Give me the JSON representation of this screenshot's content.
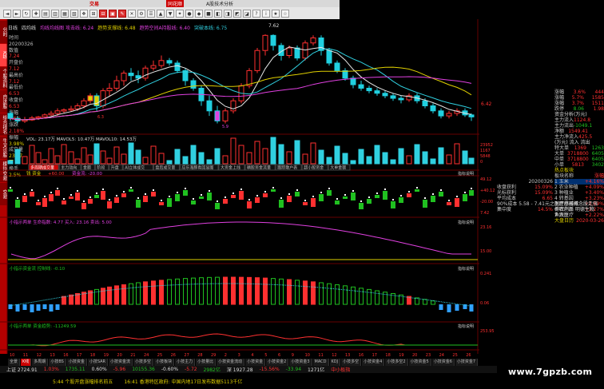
{
  "titlebar": {
    "app_brand": "同花顺",
    "menu": "交易",
    "window_title": "A股技术分析"
  },
  "toolbar": {
    "buttons": [
      "◄",
      "►",
      "↻",
      "✚",
      "▤",
      "▥",
      "▦",
      "▧",
      "❖",
      "⊞",
      "⊟",
      "▣",
      "✎",
      "✕",
      "⚙",
      "☰",
      "▲",
      "▼",
      "✦",
      "●",
      "◆",
      "■",
      "◧",
      "◨",
      "◩",
      "◪",
      "?",
      "i",
      "★",
      "☆"
    ]
  },
  "left_tabs": [
    "分时",
    "K线",
    "个股资料",
    "自选股",
    "综合排名",
    "牛叉诊股",
    "模拟交易",
    "交易"
  ],
  "info_header": {
    "period": "日线",
    "ma_label": "四均线",
    "ma5": "均线均线图 攻击线: 6.24",
    "ma10": "趋势支撑线: 6.48",
    "ma20": "趋势空间A持股线: 6.40",
    "ma60": "突破本线: 6.75"
  },
  "stock_info": [
    {
      "label": "时间",
      "value": ""
    },
    {
      "label": "20200326",
      "value": ""
    },
    {
      "label": "数值",
      "value": "7.24"
    },
    {
      "label": "开盘价",
      "value": "7.12"
    },
    {
      "label": "最高价",
      "value": "7.12"
    },
    {
      "label": "最低价",
      "value": "6.53"
    },
    {
      "label": "收盘价",
      "value": "6.53"
    },
    {
      "label": "涨幅",
      "value": "0.6%"
    },
    {
      "label": "涨跌",
      "value": "2.18%"
    },
    {
      "label": "振幅",
      "value": "3.98%"
    },
    {
      "label": "成交量",
      "value": "23.17万"
    },
    {
      "label": "换手",
      "value": "2.5%"
    }
  ],
  "price_labels": {
    "p742": "7.42",
    "p629": "6.29",
    "p5xx": "5.8",
    "p642": "6.42",
    "peak": "7.62"
  },
  "volume_panel": {
    "header": "VOL: 23.17万  MAVOL5: 10.47万  MAVOL10: 14.53万",
    "ticks": [
      "23952",
      "1167",
      "5848",
      "0"
    ],
    "h1": "万"
  },
  "indicator_tabs": [
    "多周期成交量",
    "主力动向",
    "金额",
    "阶段",
    "升盘",
    "AI立体成交",
    "盘后成交量",
    "应乐海豚看回显图",
    "大资金上线",
    "精股资金流量",
    "跟踪散户表",
    "超小股资金",
    "大单金额"
  ],
  "money_panel": {
    "title": "钱 资金",
    "v1": "+60.00",
    "v2": "资金流: -20.00",
    "v3": "6.00",
    "label_right": "指标说明",
    "ticks": [
      "49.12",
      "+40.12",
      "-20.00",
      "7.42"
    ]
  },
  "macd_panel": {
    "header": "小指示两单 生命指数: 4.77  买入: 23.16  卖出: 5.00",
    "label_right": "指标说明",
    "ticks": [
      "23.16",
      "15.00"
    ]
  },
  "hist_panel": {
    "header": "小指示资金流 控制线: -0.10",
    "label_right": "指标说明",
    "ticks": [
      "0.241",
      "0.06"
    ]
  },
  "line_panel": {
    "header": "小指示两单 资金趋势: -11249.59",
    "label_right": "指标说明",
    "ticks": [
      "253.95"
    ]
  },
  "x_axis_dates": [
    "10",
    "11",
    "12",
    "13",
    "16",
    "17",
    "18",
    "19",
    "20",
    "21",
    "24",
    "25",
    "26",
    "27",
    "28",
    "29",
    "2",
    "3",
    "4",
    "5",
    "6",
    "9",
    "10",
    "11",
    "12",
    "13",
    "16",
    "17",
    "18",
    "19",
    "20",
    "23",
    "24",
    "25",
    "26"
  ],
  "bottom_tabs": [
    "全景",
    "K线",
    "多周期",
    "小技BS",
    "小技资金",
    "小技SAR",
    "小技资金流",
    "小技多空",
    "小技板块",
    "小技主力",
    "小技量比",
    "小技资金流动",
    "小技资金",
    "小技资金2",
    "小技资金3",
    "MACD",
    "KDJ",
    "小技多空",
    "小技资金4",
    "小技多空2",
    "小技资金5",
    "小技资金6",
    "小技资金7"
  ],
  "status_bar": [
    "上证 2724.91",
    "1.03%",
    "1735.11",
    "0.60%",
    "-5.96",
    "10155.36",
    "-0.60%",
    "-5.72",
    "2982亿",
    "深 1927.28",
    "-15.56%",
    "-33.94",
    "1271亿",
    "中小板指"
  ],
  "ticker": {
    "item1": "5:44 个股开盘涨幅排名前五",
    "item2": "16:41 香港特区政府: 中国内地17日发布数据5113千亿"
  },
  "right_panel": {
    "rows": [
      {
        "l": "涨幅",
        "v1": "3.6%",
        "v2": "444"
      },
      {
        "l": "涨幅",
        "v1": "5.7%",
        "v2": "1585"
      },
      {
        "l": "涨幅",
        "v1": "3.7%",
        "v2": "1511"
      },
      {
        "l": "跌停",
        "v1": "8.06",
        "v2": "1.98"
      }
    ],
    "cash_title": "资金分析(万元)",
    "cash": [
      {
        "l": "主力流入",
        "v": "1124.8"
      },
      {
        "l": "主力流出",
        "v": "-1049.1"
      },
      {
        "l": "净额",
        "v": "1549.41"
      },
      {
        "l": "主力净流入",
        "v": "425.5"
      }
    ],
    "order_title": "(万元)  流入  流出",
    "orders": [
      {
        "l": "特大单",
        "v1": "1369",
        "v2": "1263"
      },
      {
        "l": "大单",
        "v1": "3718800",
        "v2": "6405"
      },
      {
        "l": "中单",
        "v1": "3718800",
        "v2": "6405"
      },
      {
        "l": "小单",
        "v1": "5813",
        "v2": "3402"
      }
    ],
    "hot_title": "热点板块",
    "hot": [
      {
        "l": "板块名称",
        "v": "涨幅"
      },
      {
        "l": "1 玉米",
        "v": "+4.16%"
      },
      {
        "l": "2 农业种植",
        "v": "+4.09%"
      },
      {
        "l": "3 种植业",
        "v": "+3.40%"
      },
      {
        "l": "4 转基因",
        "v": "+3.23%"
      },
      {
        "l": "5 医疗器械",
        "v": "+2.69%"
      },
      {
        "l": "6 农产品",
        "v": "+2.27%"
      },
      {
        "l": "7 大豆",
        "v": "+2.22%"
      }
    ],
    "date_title": "大盘日历",
    "date": "2020-03-26",
    "date2": "20200326",
    "financials": [
      {
        "l": "收盘获利",
        "v": "15.09%"
      },
      {
        "l": "光标获利",
        "v": "15.09%"
      },
      {
        "l": "平均成本",
        "v": "6.65"
      },
      {
        "l": "90%成本 5.58 - 7.41元之间",
        "v": ""
      },
      {
        "l": "集中度",
        "v": "14.5%"
      }
    ],
    "news": [
      "医疗器械概念股走强",
      "博晖创新 明德生物",
      "鱼跃医疗"
    ]
  },
  "watermark": "www.7gpzb.com",
  "colors": {
    "up": "#ff3030",
    "down": "#20d0e0",
    "ma_white": "#e8e8e8",
    "ma_yellow": "#e0d000",
    "ma_magenta": "#e040e0",
    "grid": "#500000"
  }
}
